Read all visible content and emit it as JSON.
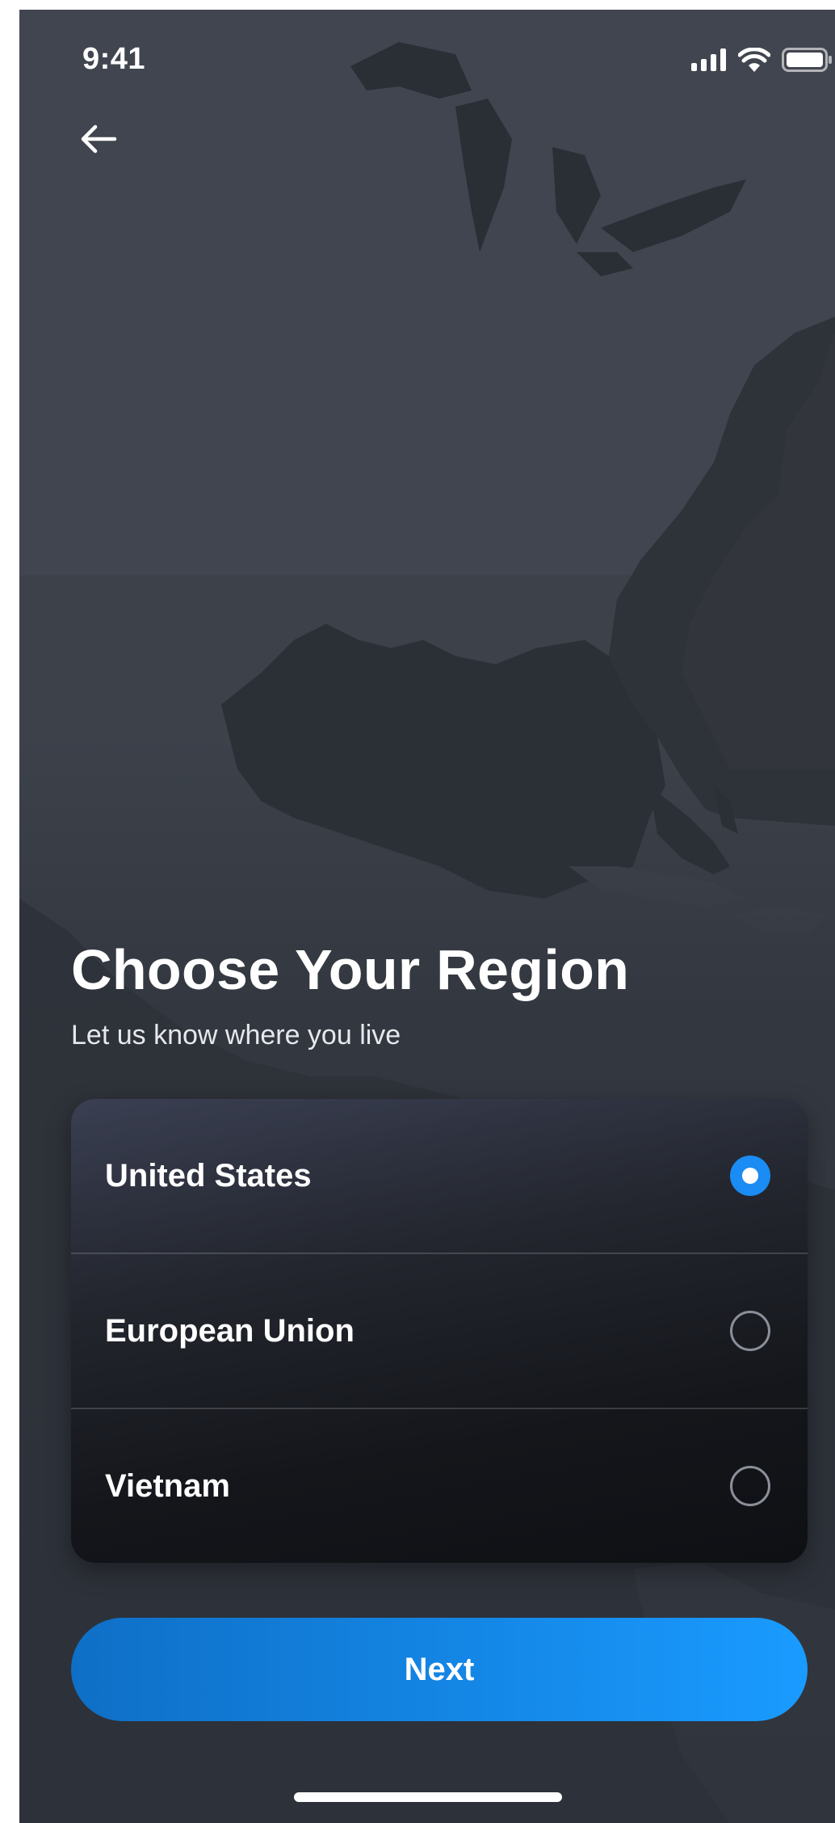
{
  "status_bar": {
    "time": "9:41",
    "icons": [
      "cellular-signal-icon",
      "wifi-icon",
      "battery-icon"
    ]
  },
  "nav": {
    "back_icon": "arrow-left-icon"
  },
  "header": {
    "title": "Choose Your Region",
    "subtitle": "Let us know where you live"
  },
  "regions": {
    "options": [
      {
        "label": "United States",
        "selected": true
      },
      {
        "label": "European Union",
        "selected": false
      },
      {
        "label": "Vietnam",
        "selected": false
      }
    ]
  },
  "actions": {
    "next_label": "Next"
  },
  "colors": {
    "background": "#2c3038",
    "accent": "#1a8cf3",
    "card_dark": "#14161b"
  }
}
